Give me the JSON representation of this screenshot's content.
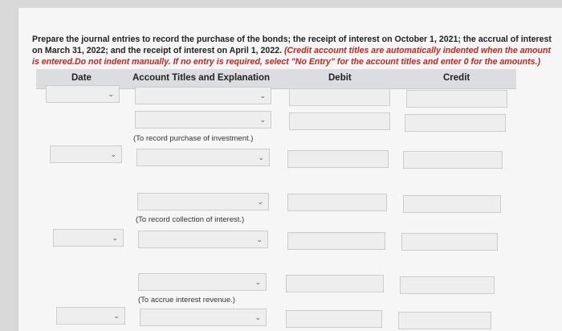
{
  "instructions": {
    "part1": "Prepare the journal entries to record the purchase of the bonds; the receipt of interest on October 1, 2021; the accrual of interest on March 31, 2022; and the receipt of interest on April 1, 2022.",
    "part2": "(Credit account titles are automatically indented when the amount is entered.Do not indent manually. If no entry is required, select \"No Entry\" for the account titles and enter 0 for the amounts.)"
  },
  "table": {
    "headers": {
      "date": "Date",
      "account": "Account Titles and Explanation",
      "debit": "Debit",
      "credit": "Credit"
    },
    "memos": [
      "(To record purchase of investment.)",
      "(To record collection of interest.)",
      "(To accrue interest revenue.)"
    ]
  },
  "icons": {
    "dropdown": "chevron-down-icon",
    "glyph": "⌄"
  },
  "colors": {
    "instruction_red": "#c4261d",
    "header_bg": "#dcdde0"
  }
}
